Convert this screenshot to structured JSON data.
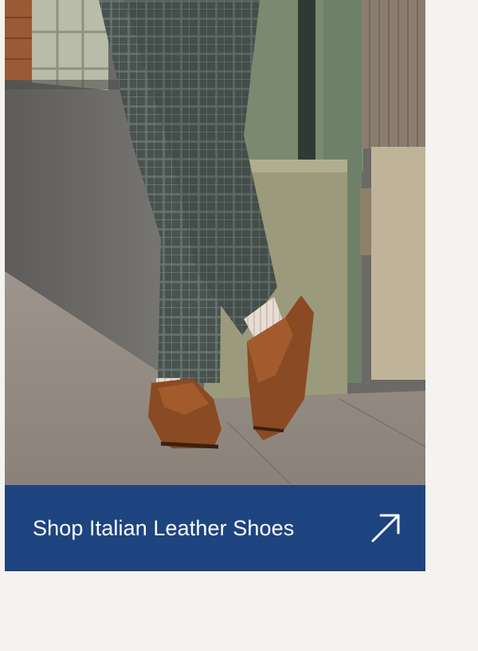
{
  "hero": {
    "image_icon": "loafers-and-plaid-trousers-photo"
  },
  "cta": {
    "label": "Shop Italian Leather Shoes",
    "icon": "arrow-up-right-icon",
    "background": "#1e4480",
    "text_color": "#ffffff"
  },
  "page": {
    "background": "#f4f3ef"
  }
}
